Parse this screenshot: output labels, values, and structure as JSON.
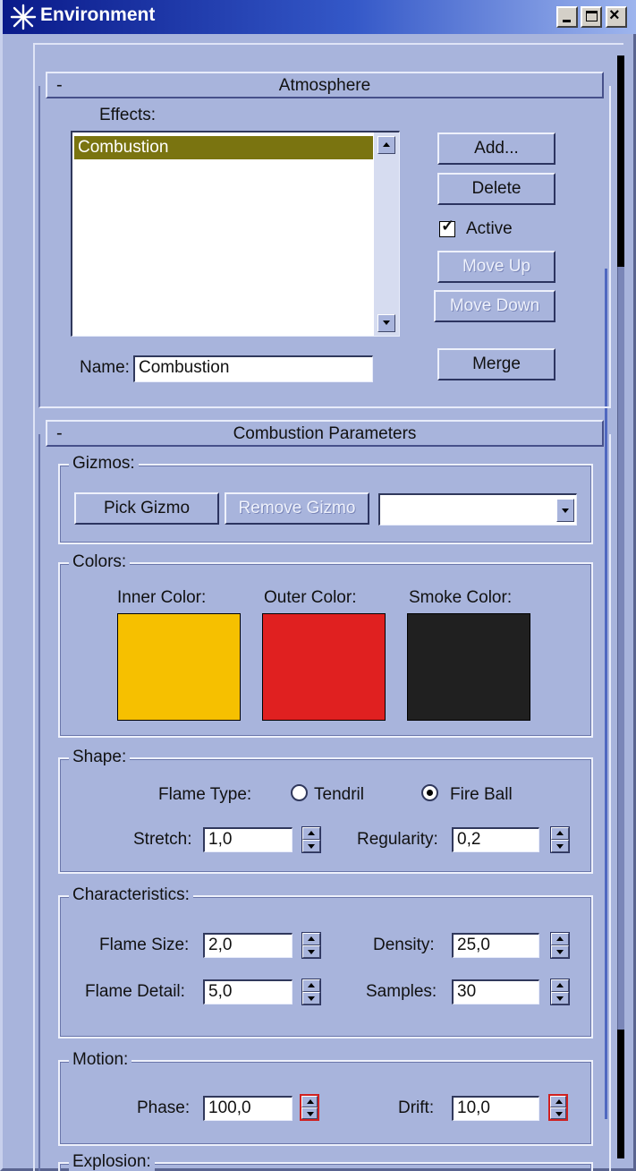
{
  "window": {
    "title": "Environment",
    "icon": "star-burst-icon"
  },
  "atmosphere": {
    "title": "Atmosphere",
    "collapse_symbol": "-",
    "effects_label": "Effects:",
    "effects": [
      "Combustion"
    ],
    "selected_effect": "Combustion",
    "buttons": {
      "add": "Add...",
      "delete": "Delete",
      "move_up": "Move Up",
      "move_down": "Move Down",
      "merge": "Merge"
    },
    "active_label": "Active",
    "active_checked": true,
    "name_label": "Name:",
    "name_value": "Combustion"
  },
  "combustion": {
    "title": "Combustion Parameters",
    "collapse_symbol": "-",
    "gizmos": {
      "title": "Gizmos:",
      "pick": "Pick Gizmo",
      "remove": "Remove Gizmo",
      "selected": ""
    },
    "colors": {
      "title": "Colors:",
      "inner_label": "Inner Color:",
      "inner": "#f6c000",
      "outer_label": "Outer Color:",
      "outer": "#e02020",
      "smoke_label": "Smoke Color:",
      "smoke": "#202020"
    },
    "shape": {
      "title": "Shape:",
      "flame_type_label": "Flame Type:",
      "tendril_label": "Tendril",
      "fireball_label": "Fire Ball",
      "selected": "Fire Ball",
      "stretch_label": "Stretch:",
      "stretch": "1,0",
      "regularity_label": "Regularity:",
      "regularity": "0,2"
    },
    "characteristics": {
      "title": "Characteristics:",
      "flame_size_label": "Flame Size:",
      "flame_size": "2,0",
      "density_label": "Density:",
      "density": "25,0",
      "flame_detail_label": "Flame Detail:",
      "flame_detail": "5,0",
      "samples_label": "Samples:",
      "samples": "30"
    },
    "motion": {
      "title": "Motion:",
      "phase_label": "Phase:",
      "phase": "100,0",
      "drift_label": "Drift:",
      "drift": "10,0"
    },
    "explosion": {
      "title": "Explosion:"
    }
  }
}
